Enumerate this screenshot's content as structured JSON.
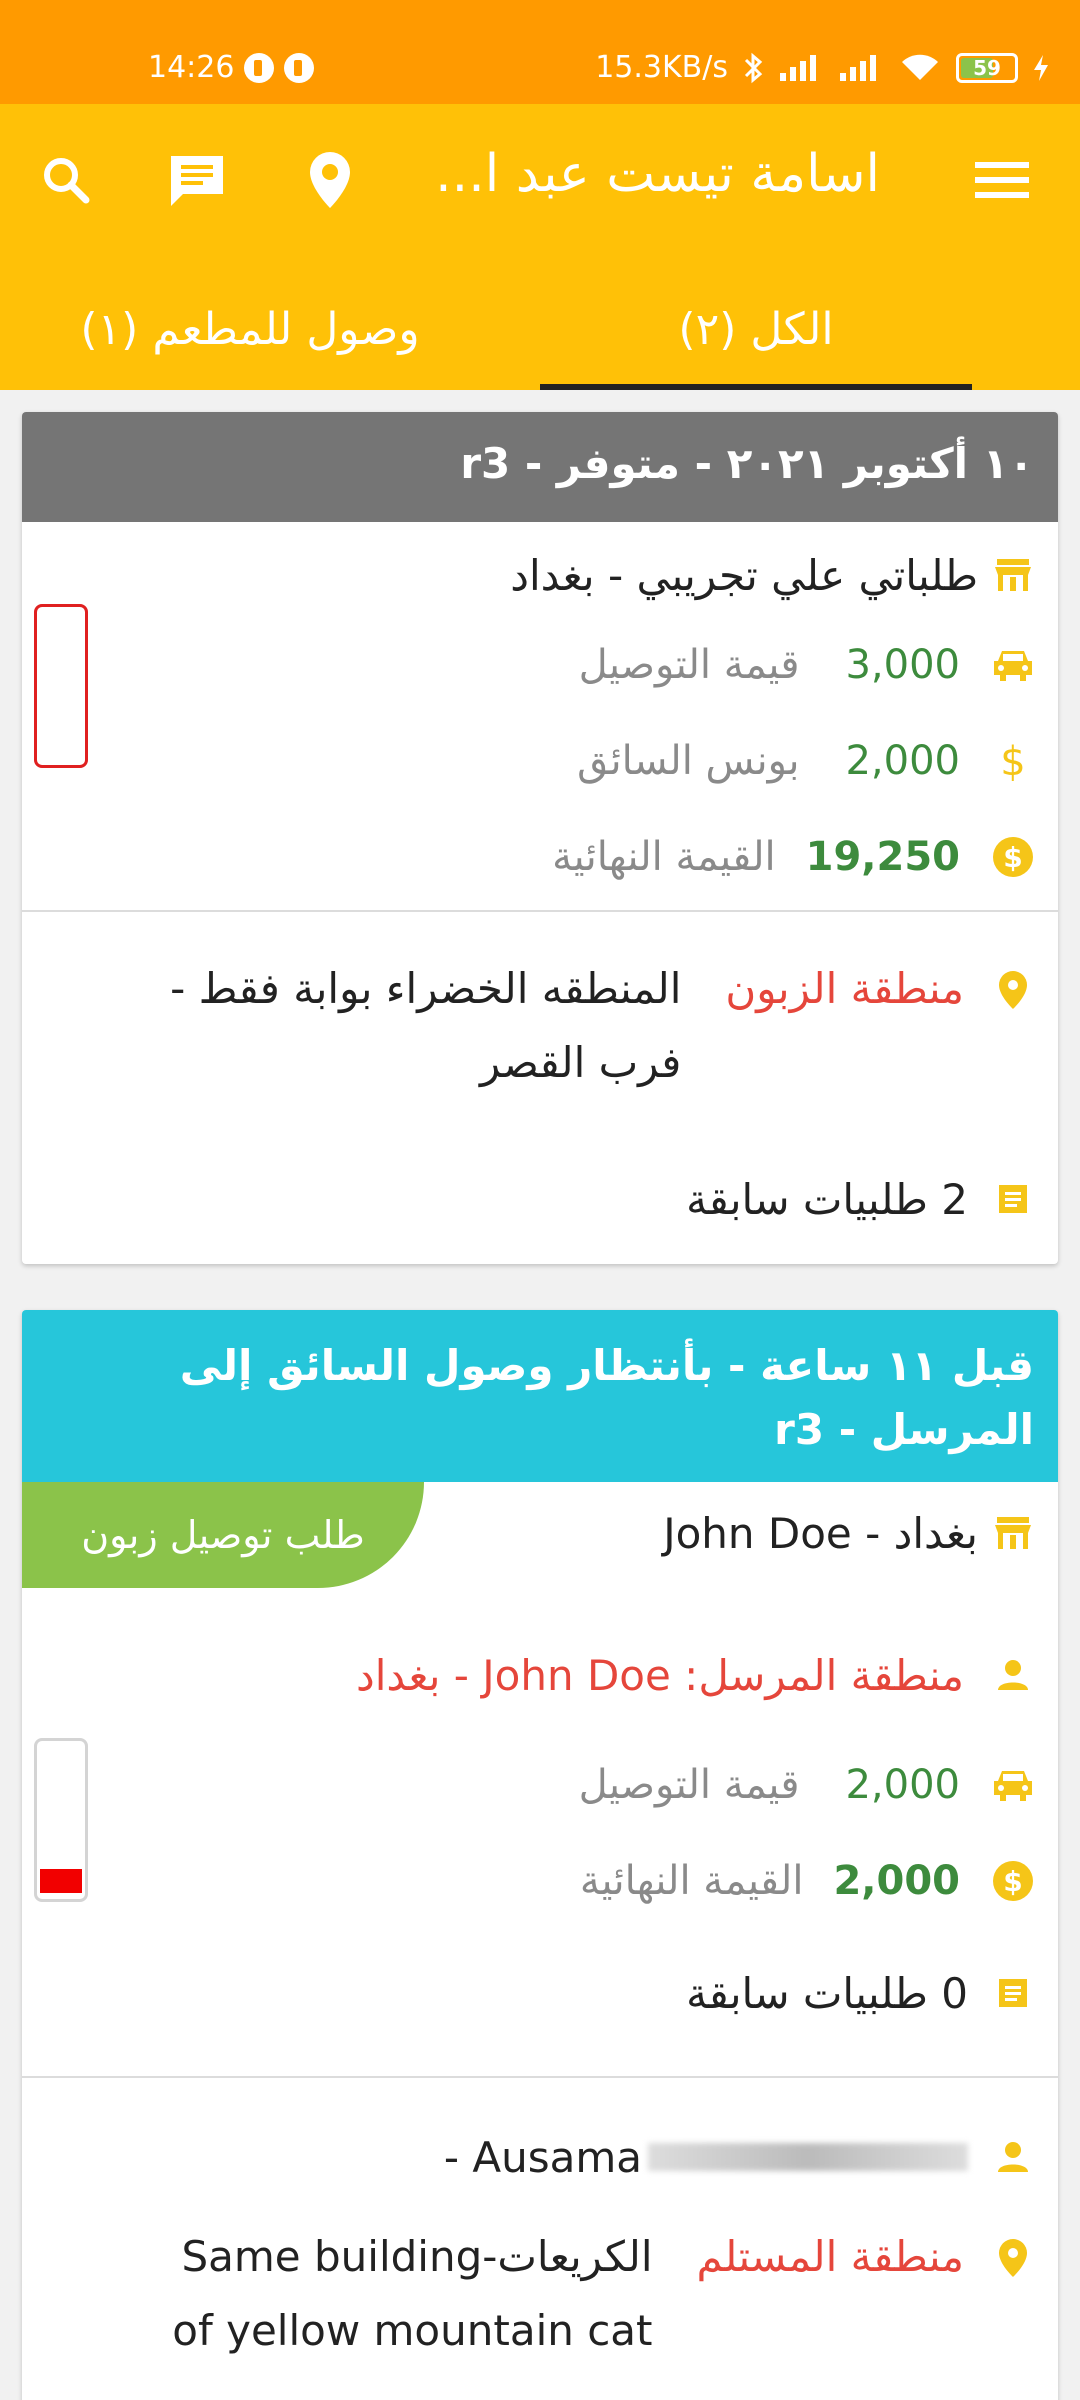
{
  "status_bar": {
    "time": "14:26",
    "net_speed": "15.3KB/s",
    "battery_level": "59"
  },
  "app_bar": {
    "title": "اسامة تيست عبد ا...",
    "tabs": [
      {
        "label": "الكل (٢)",
        "active": true
      },
      {
        "label": "وصول للمطعم (١)",
        "active": false
      }
    ]
  },
  "orders": [
    {
      "header": "١٠ أكتوبر ٢٠٢١ - متوفر - r3",
      "header_color": "#757575",
      "restaurant": "طلباتي علي تجريبي - بغداد",
      "delivery_value": "3,000",
      "delivery_label": "قيمة التوصيل",
      "bonus_value": "2,000",
      "bonus_label": "بونس السائق",
      "final_value": "19,250",
      "final_label": "القيمة النهائية",
      "customer_area_label": "منطقة الزبون",
      "customer_area_value": "المنطقه الخضراء بوابة فقط - فرب القصر",
      "prev_orders": "2 طلبيات سابقة",
      "progress": 0
    },
    {
      "header": "قبل ١١ ساعة - بأنتظار وصول السائق إلى المرسل - r3",
      "header_color": "#26c6da",
      "badge": "طلب توصيل زبون",
      "restaurant": "بغداد - John Doe",
      "sender_area": "منطقة المرسل: John Doe - بغداد",
      "delivery_value": "2,000",
      "delivery_label": "قيمة التوصيل",
      "final_value": "2,000",
      "final_label": "القيمة النهائية",
      "prev_orders": "0 طلبيات سابقة",
      "receiver_name": "Ausama -",
      "receiver_area_label": "منطقة المستلم",
      "receiver_area_value": "الكريعات-Same building of yellow mountain cat",
      "progress": 0.15
    }
  ],
  "colors": {
    "status_bar": "#ff9a00",
    "app_bar": "#ffc107",
    "icon_yellow": "#f5c518",
    "green": "#3d8b3d",
    "red": "#e5463b",
    "badge_green": "#8bc34a"
  }
}
